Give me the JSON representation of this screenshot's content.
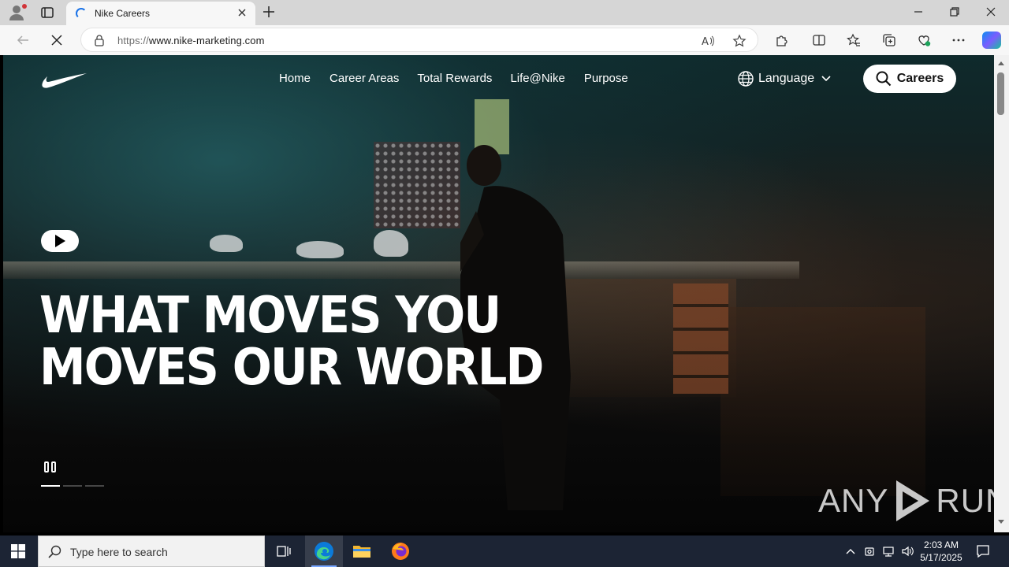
{
  "browser": {
    "tab_title": "Nike Careers",
    "url_prefix": "https://",
    "url_host": "www.nike-marketing.com"
  },
  "site": {
    "nav": [
      "Home",
      "Career Areas",
      "Total Rewards",
      "Life@Nike",
      "Purpose"
    ],
    "language_label": "Language",
    "careers_button": "Careers",
    "headline": [
      "WHAT MOVES YOU",
      "MOVES OUR WORLD"
    ],
    "slides_total": 3,
    "slide_active": 1
  },
  "watermark": {
    "left": "ANY",
    "right": "RUN"
  },
  "taskbar": {
    "search_placeholder": "Type here to search",
    "time": "2:03 AM",
    "date": "5/17/2025"
  },
  "colors": {
    "accent": "#1a73e8",
    "taskbar_bg": "#1c2434",
    "white": "#ffffff"
  },
  "icons": [
    "profile-icon",
    "tab-actions-icon",
    "loading-spinner-icon",
    "close-icon",
    "plus-icon",
    "minimize-icon",
    "restore-icon",
    "back-arrow-icon",
    "stop-loading-icon",
    "lock-icon",
    "read-aloud-icon",
    "favorite-star-icon",
    "extensions-icon",
    "split-screen-icon",
    "favorites-icon",
    "collections-icon",
    "browser-essentials-icon",
    "more-menu-icon",
    "copilot-icon",
    "nike-swoosh-logo",
    "globe-icon",
    "chevron-down-icon",
    "search-icon",
    "play-icon",
    "pause-icon",
    "windows-start-icon",
    "task-view-icon",
    "edge-icon",
    "file-explorer-icon",
    "firefox-icon",
    "chevron-up-icon",
    "network-icon",
    "volume-icon",
    "notification-icon"
  ]
}
